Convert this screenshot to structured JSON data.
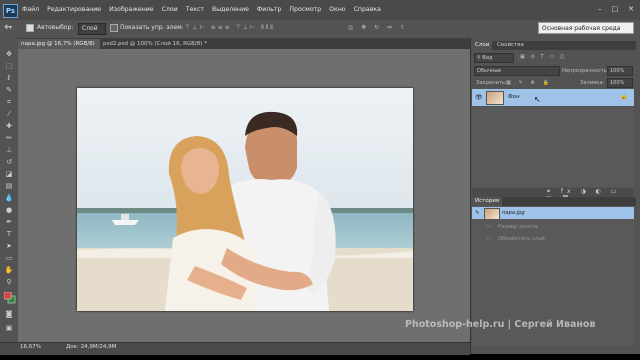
{
  "app": {
    "logo": "Ps"
  },
  "menu": [
    "Файл",
    "Редактирование",
    "Изображение",
    "Слои",
    "Текст",
    "Выделение",
    "Фильтр",
    "Просмотр",
    "Окно",
    "Справка"
  ],
  "window_controls": [
    "–",
    "□",
    "✕"
  ],
  "options_bar": {
    "autoselect_label": "Автовыбор:",
    "autoselect_value": "Слой",
    "show_controls_label": "Показать упр. элем.",
    "workspace": "Основная рабочая среда"
  },
  "documents": [
    {
      "title": "пара.jpg @ 16,7% (RGB/8) *",
      "active": true
    },
    {
      "title": "psd2.psd @ 100% (Слой 16, RGB/8) *",
      "active": false
    }
  ],
  "status": {
    "zoom": "16,67%",
    "doc": "Док: 24,9M/24,9M"
  },
  "layers_panel": {
    "tabs": [
      "Слои",
      "Свойства"
    ],
    "kind_label": "Вид",
    "blend_mode": "Обычные",
    "opacity_label": "Непрозрачность:",
    "opacity_value": "100%",
    "lock_label": "Закрепить:",
    "fill_label": "Заливка:",
    "fill_value": "100%",
    "layers": [
      {
        "name": "Фон",
        "selected": true,
        "locked": true
      }
    ]
  },
  "history_panel": {
    "tab": "История",
    "snapshot": "пара.jpg",
    "items": [
      "Размер холста",
      "Обработать слой"
    ]
  },
  "watermark": "Photoshop-help.ru | Сергей Иванов",
  "colors": {
    "accent_selected": "#9fc3e8",
    "panel_bg": "#535353",
    "canvas_bg": "#6f6f6f"
  }
}
